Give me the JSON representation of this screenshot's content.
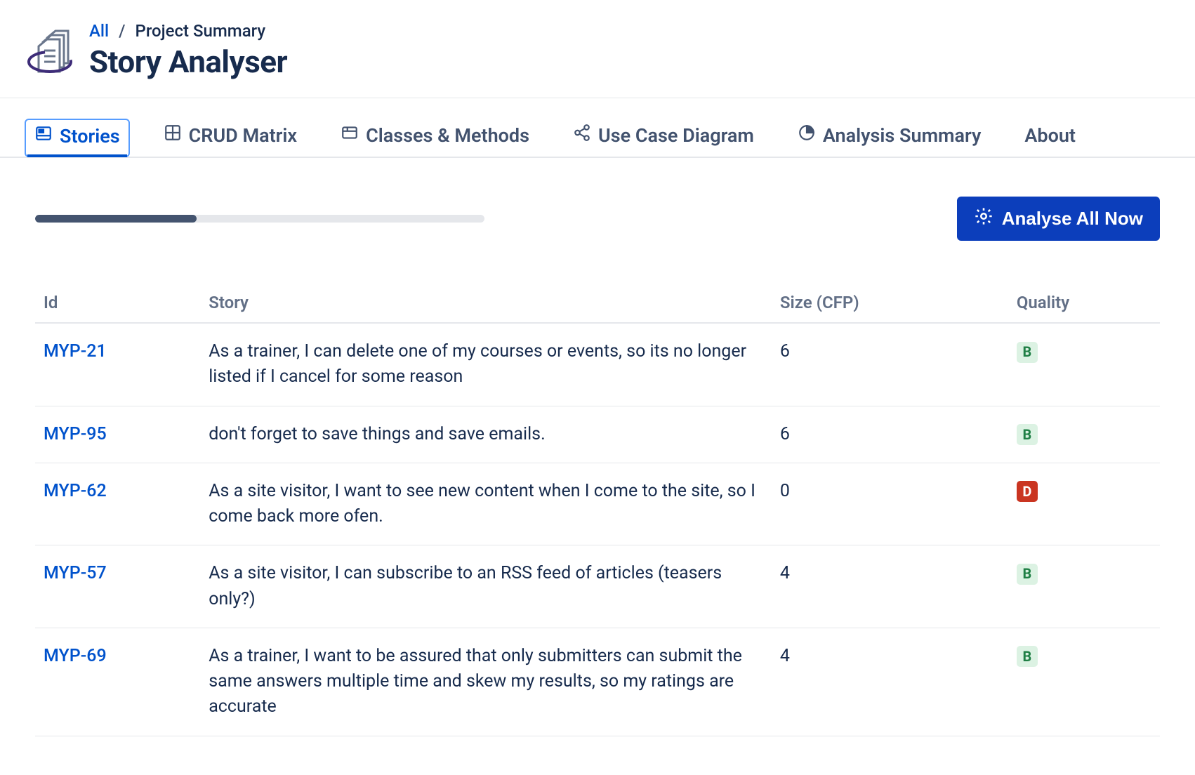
{
  "breadcrumb": {
    "all": "All",
    "sep": "/",
    "current": "Project Summary"
  },
  "page_title": "Story Analyser",
  "tabs": [
    {
      "key": "stories",
      "label": "Stories",
      "icon": "stories",
      "active": true
    },
    {
      "key": "crud",
      "label": "CRUD Matrix",
      "icon": "grid",
      "active": false
    },
    {
      "key": "classes",
      "label": "Classes & Methods",
      "icon": "window",
      "active": false
    },
    {
      "key": "usecase",
      "label": "Use Case Diagram",
      "icon": "share",
      "active": false
    },
    {
      "key": "analysis",
      "label": "Analysis Summary",
      "icon": "pie",
      "active": false
    },
    {
      "key": "about",
      "label": "About",
      "icon": "",
      "active": false
    }
  ],
  "progress_percent": 36,
  "analyse_button": "Analyse All Now",
  "table": {
    "headers": {
      "id": "Id",
      "story": "Story",
      "size": "Size (CFP)",
      "quality": "Quality"
    },
    "rows": [
      {
        "id": "MYP-21",
        "story": "As a trainer, I can delete one of my courses or events, so its no longer listed if I cancel for some reason",
        "size": "6",
        "quality": "B"
      },
      {
        "id": "MYP-95",
        "story": "don't forget to save things and save emails.",
        "size": "6",
        "quality": "B"
      },
      {
        "id": "MYP-62",
        "story": "As a site visitor, I want to see new content when I come to the site, so I come back more ofen.",
        "size": "0",
        "quality": "D"
      },
      {
        "id": "MYP-57",
        "story": "As a site visitor, I can subscribe to an RSS feed of articles (teasers only?)",
        "size": "4",
        "quality": "B"
      },
      {
        "id": "MYP-69",
        "story": "As a trainer, I want to be assured that only submitters can submit the same answers multiple time and skew my results, so my ratings are accurate",
        "size": "4",
        "quality": "B"
      }
    ]
  }
}
